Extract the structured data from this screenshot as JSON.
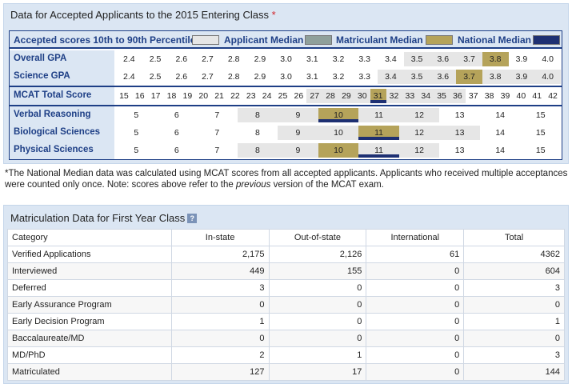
{
  "acceptance": {
    "title": "Data for Accepted Applicants to the 2015 Entering Class",
    "asterisk": "*",
    "legend": {
      "range_label": "Accepted scores 10th to 90th Percentile",
      "applicant_label": "Applicant Median",
      "matriculant_label": "Matriculant Median",
      "national_label": "National Median",
      "colors": {
        "range": "#e6e6e6",
        "applicant": "#8fa09b",
        "matriculant": "#b5a35a",
        "national": "#1e3072"
      }
    },
    "rows": [
      {
        "label": "Overall GPA",
        "values": [
          "2.4",
          "2.5",
          "2.6",
          "2.7",
          "2.8",
          "2.9",
          "3.0",
          "3.1",
          "3.2",
          "3.3",
          "3.4",
          "3.5",
          "3.6",
          "3.7",
          "3.8",
          "3.9",
          "4.0"
        ],
        "range": [
          "3.5",
          "3.7"
        ],
        "applicant_median": "3.8",
        "matriculant_median": "3.8",
        "national_median": ""
      },
      {
        "label": "Science GPA",
        "values": [
          "2.4",
          "2.5",
          "2.6",
          "2.7",
          "2.8",
          "2.9",
          "3.0",
          "3.1",
          "3.2",
          "3.3",
          "3.4",
          "3.5",
          "3.6",
          "3.7",
          "3.8",
          "3.9",
          "4.0"
        ],
        "range": [
          "3.4",
          "4.0"
        ],
        "applicant_median": "3.7",
        "matriculant_median": "3.7",
        "national_median": ""
      },
      {
        "label": "MCAT Total Score",
        "values": [
          "15",
          "16",
          "17",
          "18",
          "19",
          "20",
          "21",
          "22",
          "23",
          "24",
          "25",
          "26",
          "27",
          "28",
          "29",
          "30",
          "31",
          "32",
          "33",
          "34",
          "35",
          "36",
          "37",
          "38",
          "39",
          "40",
          "41",
          "42"
        ],
        "range": [
          "27",
          "36"
        ],
        "applicant_median": "31",
        "matriculant_median": "31",
        "national_median": "31"
      },
      {
        "label": "Verbal Reasoning",
        "values": [
          "5",
          "6",
          "7",
          "8",
          "9",
          "10",
          "11",
          "12",
          "13",
          "14",
          "15"
        ],
        "range": [
          "8",
          "12"
        ],
        "applicant_median": "10",
        "matriculant_median": "10",
        "national_median": "10"
      },
      {
        "label": "Biological Sciences",
        "values": [
          "5",
          "6",
          "7",
          "8",
          "9",
          "10",
          "11",
          "12",
          "13",
          "14",
          "15"
        ],
        "range": [
          "9",
          "13"
        ],
        "applicant_median": "11",
        "matriculant_median": "11",
        "national_median": "11"
      },
      {
        "label": "Physical Sciences",
        "values": [
          "5",
          "6",
          "7",
          "8",
          "9",
          "10",
          "11",
          "12",
          "13",
          "14",
          "15"
        ],
        "range": [
          "8",
          "12"
        ],
        "applicant_median": "10",
        "matriculant_median": "10",
        "national_median": "11"
      }
    ],
    "footnote_part1": "*The National Median data was calculated using MCAT scores from all accepted applicants. Applicants who received multiple acceptances were counted only once. Note: scores above refer to the ",
    "footnote_em": "previous",
    "footnote_part2": " version of the MCAT exam."
  },
  "matriculation": {
    "title": "Matriculation Data for First Year Class",
    "help_glyph": "?",
    "columns": [
      "Category",
      "In-state",
      "Out-of-state",
      "International",
      "Total"
    ],
    "rows": [
      [
        "Verified Applications",
        "2,175",
        "2,126",
        "61",
        "4362"
      ],
      [
        "Interviewed",
        "449",
        "155",
        "0",
        "604"
      ],
      [
        "Deferred",
        "3",
        "0",
        "0",
        "3"
      ],
      [
        "Early Assurance Program",
        "0",
        "0",
        "0",
        "0"
      ],
      [
        "Early Decision Program",
        "1",
        "0",
        "0",
        "1"
      ],
      [
        "Baccalaureate/MD",
        "0",
        "0",
        "0",
        "0"
      ],
      [
        "MD/PhD",
        "2",
        "1",
        "0",
        "3"
      ],
      [
        "Matriculated",
        "127",
        "17",
        "0",
        "144"
      ]
    ]
  }
}
